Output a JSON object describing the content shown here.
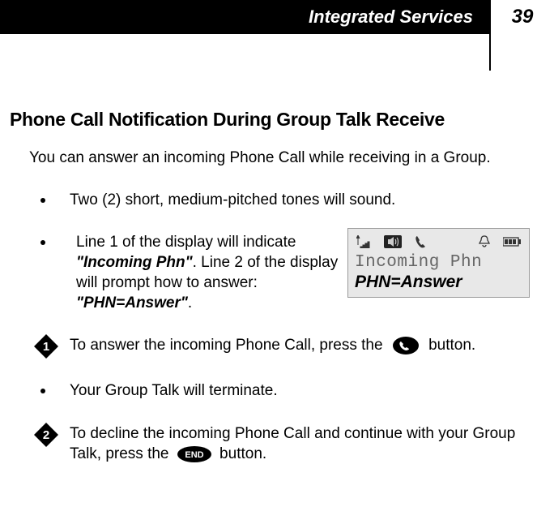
{
  "header": {
    "title": "Integrated Services",
    "page_number": "39"
  },
  "section_title": "Phone Call Notification During Group Talk Receive",
  "intro": "You can answer an incoming Phone Call while receiving in a Group.",
  "bullets": [
    {
      "text": "Two (2) short, medium-pitched tones will sound."
    },
    {
      "prefix": "Line 1 of the display will indicate ",
      "em1": "\"Incoming Phn\"",
      "mid": ". Line 2 of the display will prompt how to answer: ",
      "em2": "\"PHN=Answer\"",
      "suffix": "."
    }
  ],
  "display": {
    "line1": "Incoming Phn",
    "line2": "PHN=Answer"
  },
  "steps": [
    {
      "num": "1",
      "pre": "To answer the incoming Phone Call, press the ",
      "post": " button."
    },
    {
      "bullet": "Your Group Talk will terminate."
    },
    {
      "num": "2",
      "pre": "To decline the incoming Phone Call and continue with your Group Talk, press the ",
      "post": " button.",
      "icon_label": "END"
    }
  ]
}
